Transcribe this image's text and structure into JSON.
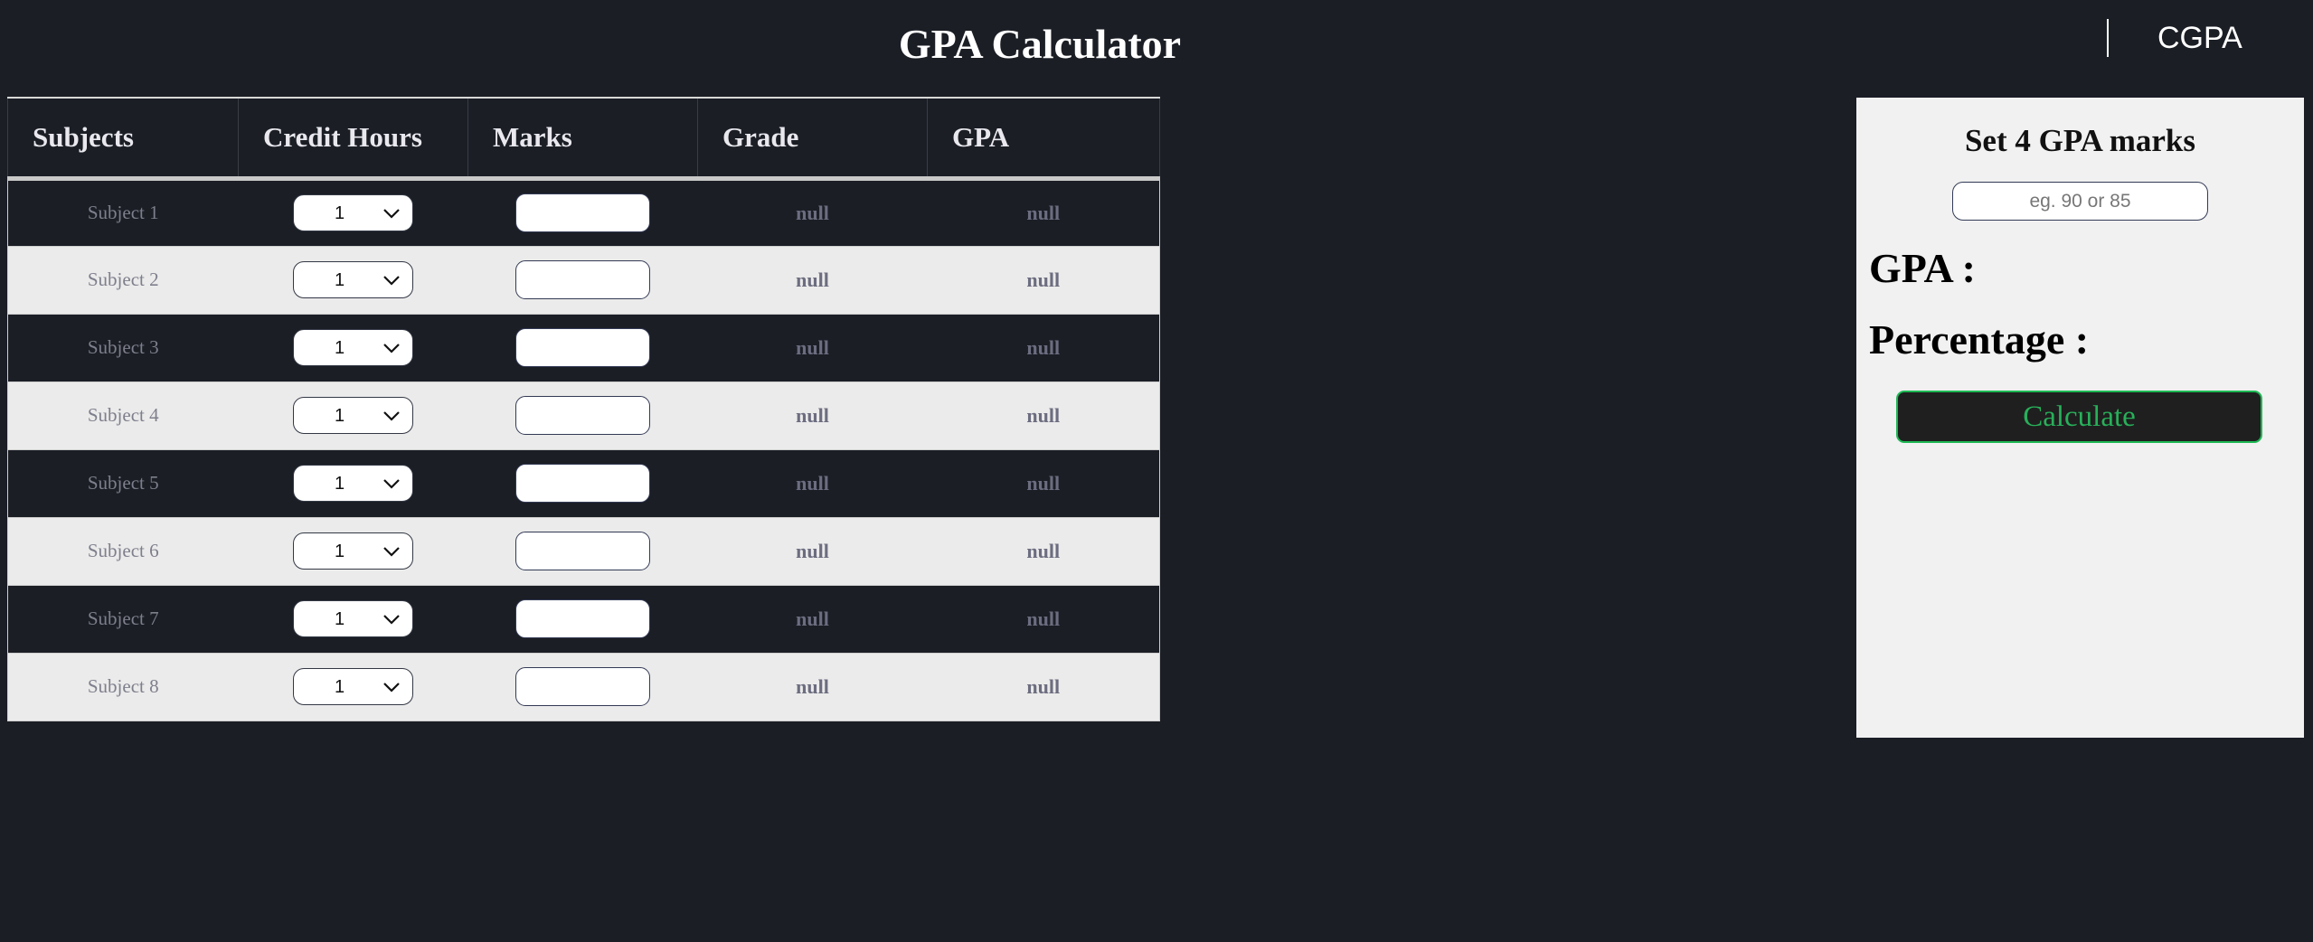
{
  "header": {
    "title": "GPA Calculator",
    "nav_link": "CGPA"
  },
  "table": {
    "columns": [
      "Subjects",
      "Credit Hours",
      "Marks",
      "Grade",
      "GPA"
    ],
    "rows": [
      {
        "subject": "Subject 1",
        "credit": "1",
        "marks": "",
        "grade": "null",
        "gpa": "null"
      },
      {
        "subject": "Subject 2",
        "credit": "1",
        "marks": "",
        "grade": "null",
        "gpa": "null"
      },
      {
        "subject": "Subject 3",
        "credit": "1",
        "marks": "",
        "grade": "null",
        "gpa": "null"
      },
      {
        "subject": "Subject 4",
        "credit": "1",
        "marks": "",
        "grade": "null",
        "gpa": "null"
      },
      {
        "subject": "Subject 5",
        "credit": "1",
        "marks": "",
        "grade": "null",
        "gpa": "null"
      },
      {
        "subject": "Subject 6",
        "credit": "1",
        "marks": "",
        "grade": "null",
        "gpa": "null"
      },
      {
        "subject": "Subject 7",
        "credit": "1",
        "marks": "",
        "grade": "null",
        "gpa": "null"
      },
      {
        "subject": "Subject 8",
        "credit": "1",
        "marks": "",
        "grade": "null",
        "gpa": "null"
      }
    ]
  },
  "panel": {
    "heading": "Set 4 GPA marks",
    "input_placeholder": "eg. 90 or 85",
    "gpa_label": "GPA :",
    "percentage_label": "Percentage :",
    "calculate_label": "Calculate"
  },
  "colors": {
    "background": "#1b1e25",
    "button_accent": "#1db954",
    "panel_bg": "#f1f1f1"
  },
  "icons": {
    "select_chevron": "chevron-down-icon"
  }
}
